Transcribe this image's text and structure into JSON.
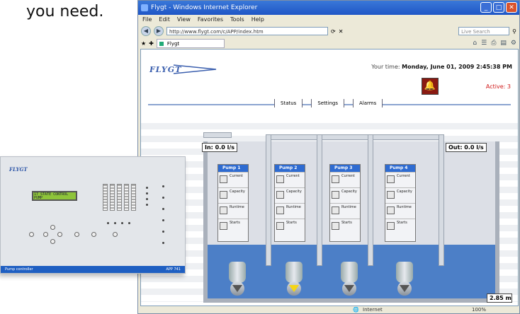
{
  "caption": "you need.",
  "browser": {
    "title": "Flygt - Windows Internet Explorer",
    "menu": [
      "File",
      "Edit",
      "View",
      "Favorites",
      "Tools",
      "Help"
    ],
    "url": "http://www.flygt.com/c/APP/index.htm",
    "search_placeholder": "Live Search",
    "tab_title": "Flygt",
    "status_zone": "Internet",
    "zoom": "100%"
  },
  "page": {
    "logo": "FLYGT",
    "time_label": "Your time:",
    "time_value": "Monday, June 01, 2009 2:45:38 PM",
    "active": "Active: 3",
    "nav": [
      "Status",
      "Settings",
      "Alarms"
    ],
    "inflow": "In: 0.0 l/s",
    "outflow": "Out: 0.0 l/s",
    "level": "2.85 m",
    "pumps": [
      {
        "label": "Pump 1",
        "running": false
      },
      {
        "label": "Pump 2",
        "running": true
      },
      {
        "label": "Pump 3",
        "running": false
      },
      {
        "label": "Pump 4",
        "running": false
      }
    ],
    "card_rows": [
      "Current",
      "Capacity",
      "Runtime",
      "Starts"
    ]
  },
  "device": {
    "logo": "FLYGT",
    "lcd_line1": "17 STATE CONTROL",
    "lcd_line2": "PUMP",
    "footer_left": "Pump controller",
    "footer_right": "APP 741"
  },
  "colors": {
    "accent": "#2e6bd1",
    "water": "#4c7fc7",
    "alarm": "#d01818",
    "running": "#f5d515"
  }
}
